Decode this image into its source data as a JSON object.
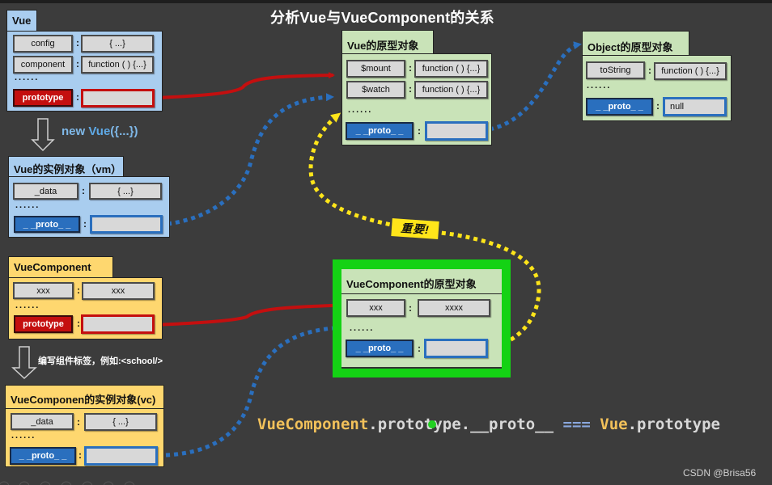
{
  "title": "分析Vue与VueComponent的关系",
  "colors": {
    "background": "#3c3c3c",
    "vue_blue": "#a9cdef",
    "component_yellow": "#fed76f",
    "prototype_green": "#c9e3b8",
    "highlight_green": "#14d214",
    "red_link": "#c40f0f",
    "proto_blue": "#2a6fbe",
    "yellow_link": "#ffe51a"
  },
  "vue": {
    "title": "Vue",
    "rows": [
      {
        "key": "config",
        "value": "{ ...}"
      },
      {
        "key": "component",
        "value": "function ( ) {...}"
      }
    ],
    "ellipsis": "......",
    "prototype_key": "prototype",
    "prototype_value": ""
  },
  "new_vue_label": {
    "prefix": "new ",
    "name": "Vue",
    "suffix": "({...})"
  },
  "vm": {
    "title": "Vue的实例对象（vm）",
    "rows": [
      {
        "key": "_data",
        "value": "{ ...}"
      }
    ],
    "ellipsis": "......",
    "proto_key": "_ _proto_ _",
    "proto_value": ""
  },
  "vue_prototype": {
    "title": "Vue的原型对象",
    "rows": [
      {
        "key": "$mount",
        "value": "function ( ) {...}"
      },
      {
        "key": "$watch",
        "value": "function ( ) {...}"
      }
    ],
    "ellipsis": "......",
    "proto_key": "_ _proto_ _",
    "proto_value": ""
  },
  "object_prototype": {
    "title": "Object的原型对象",
    "rows": [
      {
        "key": "toString",
        "value": "function ( ) {...}"
      }
    ],
    "ellipsis": "......",
    "proto_key": "_ _proto_ _",
    "proto_value": "null"
  },
  "vue_component": {
    "title": "VueComponent",
    "rows": [
      {
        "key": "xxx",
        "value": "xxx"
      }
    ],
    "ellipsis": "......",
    "prototype_key": "prototype",
    "prototype_value": ""
  },
  "component_tag_label": "编写组件标签，例如:<school/>",
  "vc": {
    "title": "VueComponen的实例对象(vc)",
    "rows": [
      {
        "key": "_data",
        "value": "{ ...}"
      }
    ],
    "ellipsis": "......",
    "proto_key": "_ _proto_ _",
    "proto_value": ""
  },
  "vue_component_prototype": {
    "title": "VueComponent的原型对象",
    "rows": [
      {
        "key": "xxx",
        "value": "xxxx"
      }
    ],
    "ellipsis": "......",
    "proto_key": "_ _proto_ _",
    "proto_value": ""
  },
  "important_badge": "重要!",
  "colon": ":",
  "formula": {
    "part1": "VueComponent",
    "part2": ".prototype.__proto__",
    "op": " === ",
    "part3": "Vue",
    "part4": ".prototype"
  },
  "watermark": "CSDN @Brisa56"
}
